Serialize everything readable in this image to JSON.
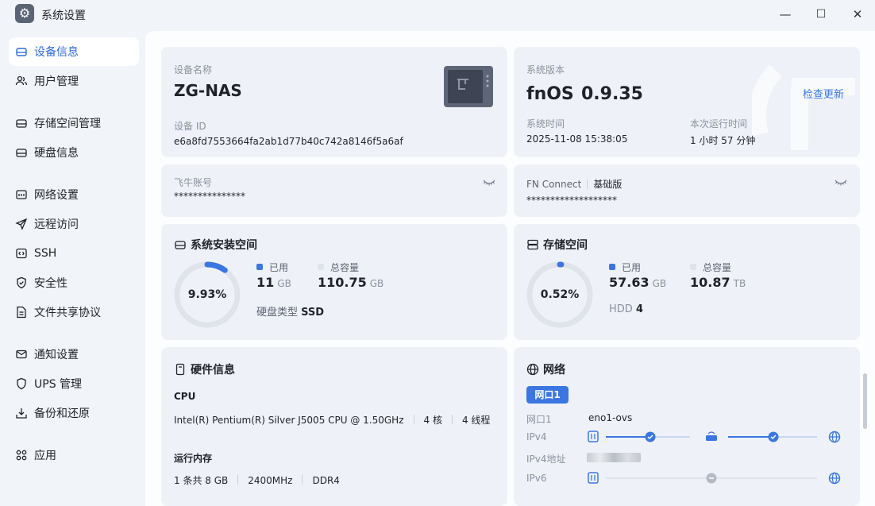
{
  "window": {
    "title": "系统设置",
    "minimize": "—",
    "maximize": "☐",
    "close": "✕"
  },
  "sidebar": {
    "items": [
      {
        "label": "设备信息",
        "icon": "device-icon",
        "active": true
      },
      {
        "label": "用户管理",
        "icon": "users-icon"
      },
      {
        "label": "存储空间管理",
        "icon": "storage-icon"
      },
      {
        "label": "硬盘信息",
        "icon": "disk-icon"
      },
      {
        "label": "网络设置",
        "icon": "network-icon"
      },
      {
        "label": "远程访问",
        "icon": "send-icon"
      },
      {
        "label": "SSH",
        "icon": "terminal-icon"
      },
      {
        "label": "安全性",
        "icon": "shield-icon"
      },
      {
        "label": "文件共享协议",
        "icon": "file-icon"
      },
      {
        "label": "通知设置",
        "icon": "mail-icon"
      },
      {
        "label": "UPS 管理",
        "icon": "power-icon"
      },
      {
        "label": "备份和还原",
        "icon": "backup-icon"
      },
      {
        "label": "应用",
        "icon": "apps-icon"
      }
    ]
  },
  "device": {
    "name_label": "设备名称",
    "name": "ZG-NAS",
    "id_label": "设备 ID",
    "id": "e6a8fd7553664fa2ab1d77b40c742a8146f5a6af"
  },
  "system": {
    "version_label": "系统版本",
    "os": "fnOS",
    "version": "0.9.35",
    "check_update": "检查更新",
    "time_label": "系统时间",
    "time": "2025-11-08 15:38:05",
    "uptime_label": "本次运行时间",
    "uptime": "1 小时 57 分钟"
  },
  "account": {
    "label": "飞牛账号",
    "value": "***************"
  },
  "fnconnect": {
    "label": "FN Connect",
    "edition": "基础版",
    "value": "*******************"
  },
  "sys_space": {
    "title": "系统安装空间",
    "percent_text": "9.93%",
    "percent": 9.93,
    "used_label": "已用",
    "used": "11",
    "used_unit": "GB",
    "total_label": "总容量",
    "total": "110.75",
    "total_unit": "GB",
    "type_label": "硬盘类型",
    "type": "SSD"
  },
  "storage": {
    "title": "存储空间",
    "percent_text": "0.52%",
    "percent": 0.52,
    "used_label": "已用",
    "used": "57.63",
    "used_unit": "GB",
    "total_label": "总容量",
    "total": "10.87",
    "total_unit": "TB",
    "type_label": "HDD",
    "type": "4"
  },
  "hardware": {
    "title": "硬件信息",
    "cpu_label": "CPU",
    "cpu": "Intel(R) Pentium(R) Silver J5005 CPU @ 1.50GHz",
    "cores": "4 核",
    "threads": "4 线程",
    "mem_label": "运行内存",
    "mem": "1 条共 8 GB",
    "speed": "2400MHz",
    "mem_type": "DDR4"
  },
  "network": {
    "title": "网络",
    "port_tab": "网口1",
    "port_label": "网口1",
    "port": "eno1-ovs",
    "ipv4_label": "IPv4",
    "ipv4addr_label": "IPv4地址",
    "ipv6_label": "IPv6"
  },
  "colors": {
    "accent": "#3b76e1",
    "card": "#eef2f8",
    "track": "#dfe3ea"
  }
}
